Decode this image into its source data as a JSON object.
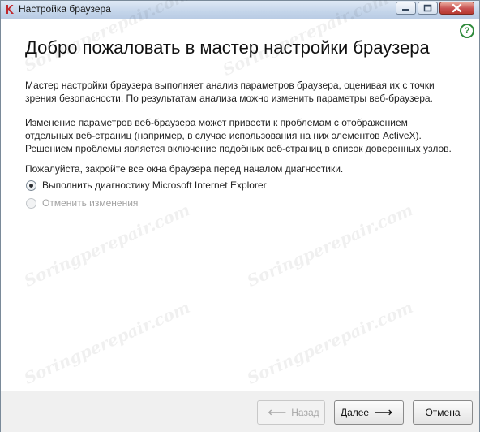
{
  "window": {
    "title": "Настройка браузера"
  },
  "main": {
    "heading": "Добро пожаловать в мастер настройки браузера",
    "intro": "Мастер настройки браузера выполняет анализ параметров браузера, оценивая их с точки зрения безопасности. По результатам анализа можно изменить параметры веб-браузера.",
    "warning_line1": "Изменение параметров веб-браузера может привести к проблемам с отображением",
    "warning_line2": "отдельных веб-страниц (например, в случае использования на них элементов ActiveX).",
    "warning_line3": "Решением проблемы является включение подобных веб-страниц в список доверенных узлов.",
    "instruction": "Пожалуйста, закройте все окна браузера перед началом диагностики.",
    "options": [
      {
        "label": "Выполнить диагностику Microsoft Internet Explorer",
        "selected": true,
        "enabled": true
      },
      {
        "label": "Отменить изменения",
        "selected": false,
        "enabled": false
      }
    ]
  },
  "footer": {
    "back_label": "Назад",
    "next_label": "Далее",
    "cancel_label": "Отмена"
  },
  "watermark": "Soringperepair.com",
  "colors": {
    "help_icon": "#2e8a3a",
    "close_button": "#c75050"
  }
}
